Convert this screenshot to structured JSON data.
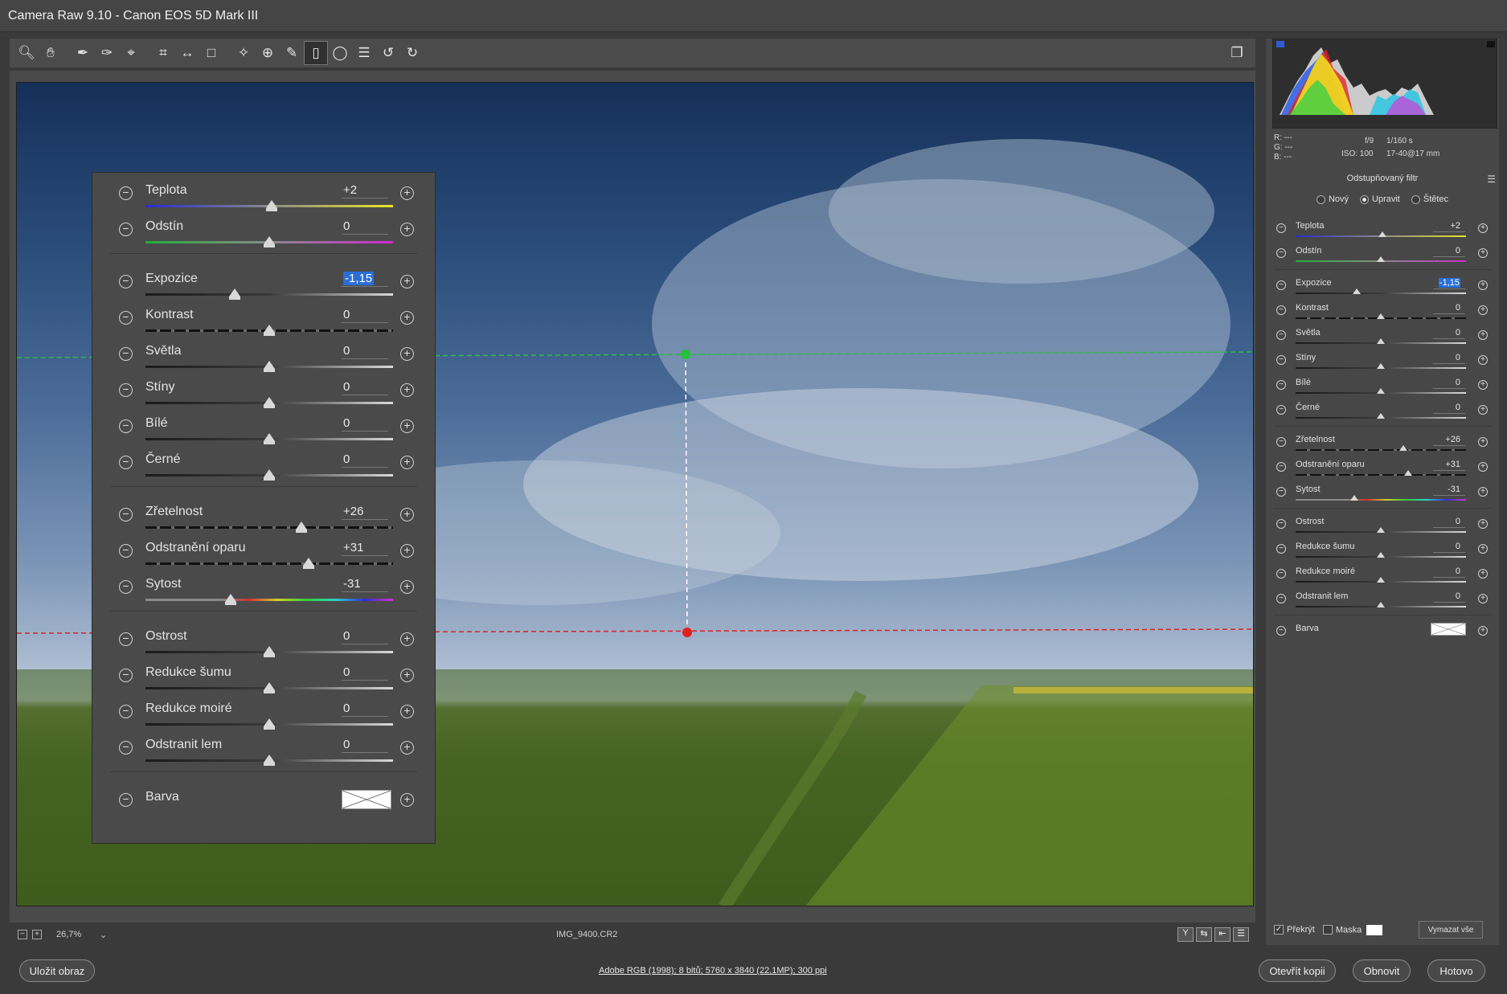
{
  "window": {
    "title": "Camera Raw 9.10  -  Canon EOS 5D Mark III"
  },
  "toolbar": {
    "icons": [
      "zoom-icon",
      "hand-icon",
      "white-balance-icon",
      "color-sampler-icon",
      "target-adjustment-icon",
      "crop-icon",
      "straighten-icon",
      "transform-icon",
      "spot-removal-icon",
      "red-eye-icon",
      "adjustment-brush-icon",
      "graduated-filter-icon",
      "radial-filter-icon",
      "preferences-icon",
      "rotate-ccw-icon",
      "rotate-cw-icon"
    ],
    "active": "graduated-filter-icon"
  },
  "histogram": {
    "r": "R:  ---",
    "g": "G:  ---",
    "b": "B:  ---",
    "aperture": "f/9",
    "shutter": "1/160 s",
    "iso": "ISO: 100",
    "lens": "17-40@17 mm"
  },
  "panel": {
    "title": "Odstupňovaný filtr",
    "modes": [
      {
        "label": "Nový",
        "on": false
      },
      {
        "label": "Upravit",
        "on": true
      },
      {
        "label": "Štětec",
        "on": false
      }
    ]
  },
  "sliders": [
    {
      "label": "Teplota",
      "value": "+2",
      "pos": 0.51,
      "track": "temp"
    },
    {
      "label": "Odstín",
      "value": "0",
      "pos": 0.5,
      "track": "tint"
    },
    {
      "sep": true
    },
    {
      "label": "Expozice",
      "value": "-1,15",
      "pos": 0.36,
      "track": "plain",
      "selected": true
    },
    {
      "label": "Kontrast",
      "value": "0",
      "pos": 0.5,
      "track": "dash"
    },
    {
      "label": "Světla",
      "value": "0",
      "pos": 0.5,
      "track": "plain"
    },
    {
      "label": "Stíny",
      "value": "0",
      "pos": 0.5,
      "track": "plain"
    },
    {
      "label": "Bílé",
      "value": "0",
      "pos": 0.5,
      "track": "plain"
    },
    {
      "label": "Černé",
      "value": "0",
      "pos": 0.5,
      "track": "plain"
    },
    {
      "sep": true
    },
    {
      "label": "Zřetelnost",
      "value": "+26",
      "pos": 0.63,
      "track": "dash"
    },
    {
      "label": "Odstranění oparu",
      "value": "+31",
      "pos": 0.66,
      "track": "dash"
    },
    {
      "label": "Sytost",
      "value": "-31",
      "pos": 0.345,
      "track": "sat"
    },
    {
      "sep": true
    },
    {
      "label": "Ostrost",
      "value": "0",
      "pos": 0.5,
      "track": "plain"
    },
    {
      "label": "Redukce šumu",
      "value": "0",
      "pos": 0.5,
      "track": "plain"
    },
    {
      "label": "Redukce moiré",
      "value": "0",
      "pos": 0.5,
      "track": "plain"
    },
    {
      "label": "Odstranit lem",
      "value": "0",
      "pos": 0.5,
      "track": "plain"
    },
    {
      "sep": true
    },
    {
      "label": "Barva",
      "swatch": true
    }
  ],
  "bottom": {
    "zoom": "26,7%",
    "filename": "IMG_9400.CR2",
    "view_buttons": [
      "Y",
      "⇆",
      "⇤",
      "☰"
    ]
  },
  "right_bottom": {
    "overlay": "Překrýt",
    "mask": "Maska",
    "clear": "Vymazat vše"
  },
  "footer": {
    "save": "Uložit obraz",
    "info": "Adobe RGB (1998); 8 bitů; 5760 x 3840 (22,1MP); 300 ppi",
    "open_copy": "Otevřít kopii",
    "reset": "Obnovit",
    "done": "Hotovo"
  },
  "colors": {
    "accent": "#2a6fd6",
    "green_pin": "#23c23a",
    "red_pin": "#e02020"
  }
}
